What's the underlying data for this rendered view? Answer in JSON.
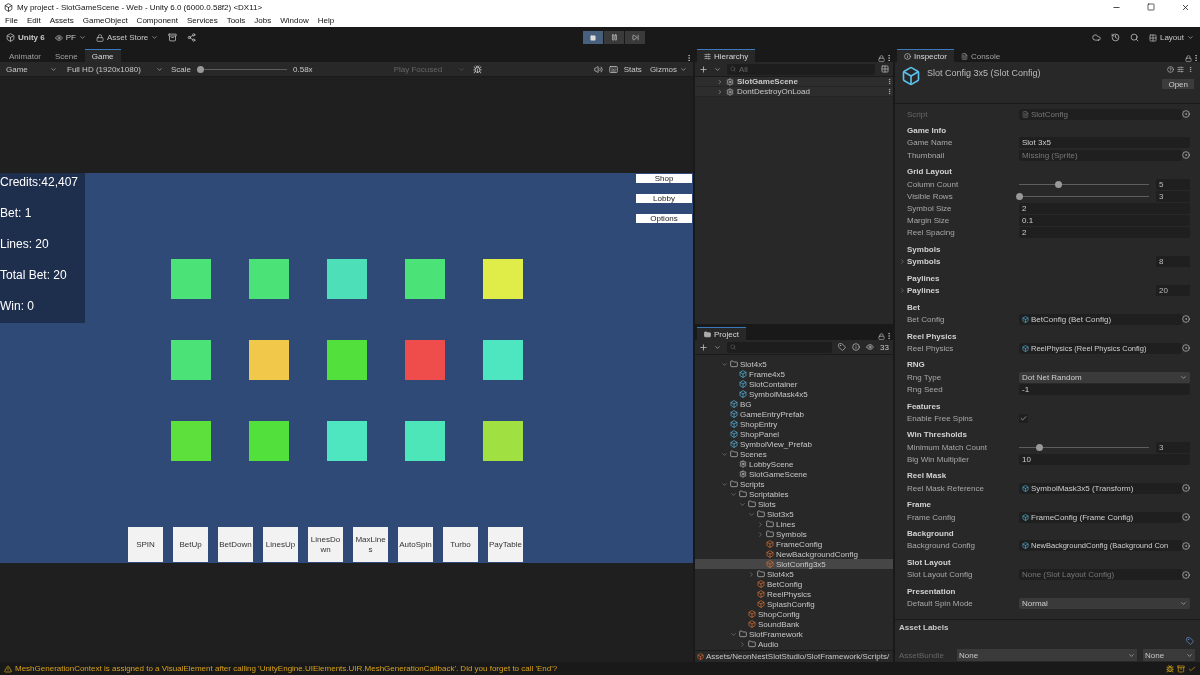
{
  "window": {
    "title": "My project - SlotGameScene - Web - Unity 6.0 (6000.0.58f2) <DX11>"
  },
  "menu": [
    "File",
    "Edit",
    "Assets",
    "GameObject",
    "Component",
    "Services",
    "Tools",
    "Jobs",
    "Window",
    "Help"
  ],
  "toolbar": {
    "account": "Unity 6",
    "user": "PF",
    "store": "Asset Store",
    "playing": true,
    "layout": "Layout"
  },
  "game_panel": {
    "tabs": [
      {
        "label": "Animator",
        "selected": false
      },
      {
        "label": "Scene",
        "selected": false
      },
      {
        "label": "Game",
        "selected": true
      }
    ],
    "display": "Game",
    "resolution": "Full HD (1920x1080)",
    "scale_label": "Scale",
    "scale": {
      "level": 0
    },
    "scale_reading": "0.58x",
    "play_focused": "Play Focused",
    "stats": "Stats",
    "gizmos": "Gizmos"
  },
  "game": {
    "stats": [
      "Credits:42,407",
      "Bet: 1",
      "Lines: 20",
      "Total Bet: 20",
      "Win: 0"
    ],
    "menu_buttons": [
      "Shop",
      "Lobby",
      "Options"
    ],
    "reels": [
      [
        {
          "color": "#4be278"
        },
        {
          "color": "#4be278"
        },
        {
          "color": "#4de0b8"
        },
        {
          "color": "#4be278"
        },
        {
          "color": "#e0ec48"
        }
      ],
      [
        {
          "color": "#4be278"
        },
        {
          "color": "#f2c84a"
        },
        {
          "color": "#52e03c"
        },
        {
          "color": "#ef4c4c"
        },
        {
          "color": "#4de6c0"
        }
      ],
      [
        {
          "color": "#5de03c"
        },
        {
          "color": "#52e03c"
        },
        {
          "color": "#4de6c0"
        },
        {
          "color": "#4de6b8"
        },
        {
          "color": "#a0e040"
        }
      ]
    ],
    "controls": [
      "SPIN",
      "BetUp",
      "BetDown",
      "LinesUp",
      "LinesDown",
      "MaxLines",
      "AutoSpin",
      "Turbo",
      "PayTable"
    ]
  },
  "hierarchy": {
    "title": "Hierarchy",
    "search": {
      "placeholder": "All"
    },
    "scenes": [
      {
        "name": "SlotGameScene",
        "active": true
      },
      {
        "name": "DontDestroyOnLoad",
        "active": false
      }
    ]
  },
  "project": {
    "title": "Project",
    "count": "33",
    "path": "Assets/NeonNestSlotStudio/SlotFramework/Scripts/",
    "tree": [
      {
        "name": "Slot4x5",
        "kind": "folder",
        "expanded": true,
        "selected": false,
        "children": [
          {
            "name": "Frame4x5",
            "kind": "prefab",
            "selected": false
          },
          {
            "name": "SlotContainer",
            "kind": "prefab",
            "selected": false
          },
          {
            "name": "SymbolMask4x5",
            "kind": "prefab",
            "selected": false
          }
        ]
      },
      {
        "name": "BG",
        "kind": "prefab",
        "selected": false
      },
      {
        "name": "GameEntryPrefab",
        "kind": "prefab",
        "selected": false
      },
      {
        "name": "ShopEntry",
        "kind": "prefab",
        "selected": false
      },
      {
        "name": "ShopPanel",
        "kind": "prefab",
        "selected": false
      },
      {
        "name": "SymbolView_Prefab",
        "kind": "prefab",
        "selected": false
      },
      {
        "name": "Scenes",
        "kind": "folder",
        "expanded": true,
        "selected": false,
        "children": [
          {
            "name": "LobbyScene",
            "kind": "scene",
            "selected": false
          },
          {
            "name": "SlotGameScene",
            "kind": "scene",
            "selected": false
          }
        ]
      },
      {
        "name": "Scripts",
        "kind": "folder",
        "expanded": true,
        "selected": false,
        "children": [
          {
            "name": "Scriptables",
            "kind": "folder",
            "expanded": true,
            "selected": false,
            "children": [
              {
                "name": "Slots",
                "kind": "folder",
                "expanded": true,
                "selected": false,
                "children": [
                  {
                    "name": "Slot3x5",
                    "kind": "folder",
                    "expanded": true,
                    "selected": false,
                    "children": [
                      {
                        "name": "Lines",
                        "kind": "folder",
                        "expanded": false,
                        "selected": false
                      },
                      {
                        "name": "Symbols",
                        "kind": "folder",
                        "expanded": false,
                        "selected": false
                      },
                      {
                        "name": "FrameConfig",
                        "kind": "asset",
                        "selected": false
                      },
                      {
                        "name": "NewBackgroundConfig",
                        "kind": "asset",
                        "selected": false
                      },
                      {
                        "name": "SlotConfig3x5",
                        "kind": "asset",
                        "selected": true
                      }
                    ]
                  },
                  {
                    "name": "Slot4x5",
                    "kind": "folder",
                    "expanded": false,
                    "selected": false
                  },
                  {
                    "name": "BetConfig",
                    "kind": "asset",
                    "selected": false
                  },
                  {
                    "name": "ReelPhysics",
                    "kind": "asset",
                    "selected": false
                  },
                  {
                    "name": "SplashConfig",
                    "kind": "asset",
                    "selected": false
                  }
                ]
              },
              {
                "name": "ShopConfig",
                "kind": "asset",
                "selected": false
              },
              {
                "name": "SoundBank",
                "kind": "asset",
                "selected": false
              }
            ]
          },
          {
            "name": "SlotFramework",
            "kind": "folder",
            "expanded": true,
            "selected": false,
            "children": [
              {
                "name": "Audio",
                "kind": "folder",
                "expanded": false,
                "selected": false
              }
            ]
          }
        ]
      }
    ]
  },
  "inspector": {
    "tabs": [
      {
        "label": "Inspector",
        "selected": true
      },
      {
        "label": "Console",
        "selected": false
      }
    ],
    "title": "Slot Config 3x5 (Slot Config)",
    "open": "Open",
    "fields": [
      {
        "kind": "script",
        "label": "Script",
        "value": "SlotConfig"
      },
      {
        "kind": "header",
        "label": "Game Info"
      },
      {
        "kind": "text",
        "label": "Game Name",
        "value": "Slot 3x5"
      },
      {
        "kind": "object",
        "label": "Thumbnail",
        "value": "Missing (Sprite)",
        "empty": true
      },
      {
        "kind": "header",
        "label": "Grid Layout"
      },
      {
        "kind": "slider",
        "label": "Column Count",
        "level": 0.3,
        "value": "5"
      },
      {
        "kind": "slider",
        "label": "Visible Rows",
        "level": 0,
        "value": "3"
      },
      {
        "kind": "text",
        "label": "Symbol Size",
        "value": "2"
      },
      {
        "kind": "text",
        "label": "Margin Size",
        "value": "0.1"
      },
      {
        "kind": "text",
        "label": "Reel Spacing",
        "value": "2"
      },
      {
        "kind": "header",
        "label": "Symbols"
      },
      {
        "kind": "list",
        "label": "Symbols",
        "value": "8",
        "expanded": false
      },
      {
        "kind": "header",
        "label": "Paylines"
      },
      {
        "kind": "list",
        "label": "Paylines",
        "value": "20",
        "expanded": false
      },
      {
        "kind": "header",
        "label": "Bet"
      },
      {
        "kind": "object",
        "label": "Bet Config",
        "value": "BetConfig (Bet Config)",
        "empty": false
      },
      {
        "kind": "header",
        "label": "Reel Physics"
      },
      {
        "kind": "object",
        "label": "Reel Physics",
        "value": "ReelPhysics (Reel Physics Config)",
        "empty": false
      },
      {
        "kind": "header",
        "label": "RNG"
      },
      {
        "kind": "dropdown",
        "label": "Rng Type",
        "value": "Dot Net Random"
      },
      {
        "kind": "text",
        "label": "Rng Seed",
        "value": "-1"
      },
      {
        "kind": "header",
        "label": "Features"
      },
      {
        "kind": "checkbox",
        "label": "Enable Free Spins",
        "checked": true
      },
      {
        "kind": "header",
        "label": "Win Thresholds"
      },
      {
        "kind": "slider",
        "label": "Minimum Match Count",
        "level": 0.15,
        "value": "3"
      },
      {
        "kind": "text",
        "label": "Big Win Multiplier",
        "value": "10"
      },
      {
        "kind": "header",
        "label": "Reel Mask"
      },
      {
        "kind": "object",
        "label": "Reel Mask Reference",
        "value": "SymbolMask3x5 (Transform)",
        "empty": false
      },
      {
        "kind": "header",
        "label": "Frame"
      },
      {
        "kind": "object",
        "label": "Frame Config",
        "value": "FrameConfig (Frame Config)",
        "empty": false
      },
      {
        "kind": "header",
        "label": "Background"
      },
      {
        "kind": "object",
        "label": "Background Config",
        "value": "NewBackgroundConfig (Background Con",
        "empty": false
      },
      {
        "kind": "header",
        "label": "Slot Layout"
      },
      {
        "kind": "object",
        "label": "Slot Layout Config",
        "value": "None (Slot Layout Config)",
        "empty": true
      },
      {
        "kind": "header",
        "label": "Presentation"
      },
      {
        "kind": "dropdown",
        "label": "Default Spin Mode",
        "value": "Normal"
      }
    ],
    "asset_labels": "Asset Labels",
    "asset_bundle": {
      "label": "AssetBundle",
      "value": "None",
      "variant": "None"
    }
  },
  "status": {
    "message": "MeshGenerationContext is assigned to a VisualElement after calling 'UnityEngine.UIElements.UIR.MeshGenerationCallback'. Did you forget to call 'End'?"
  }
}
